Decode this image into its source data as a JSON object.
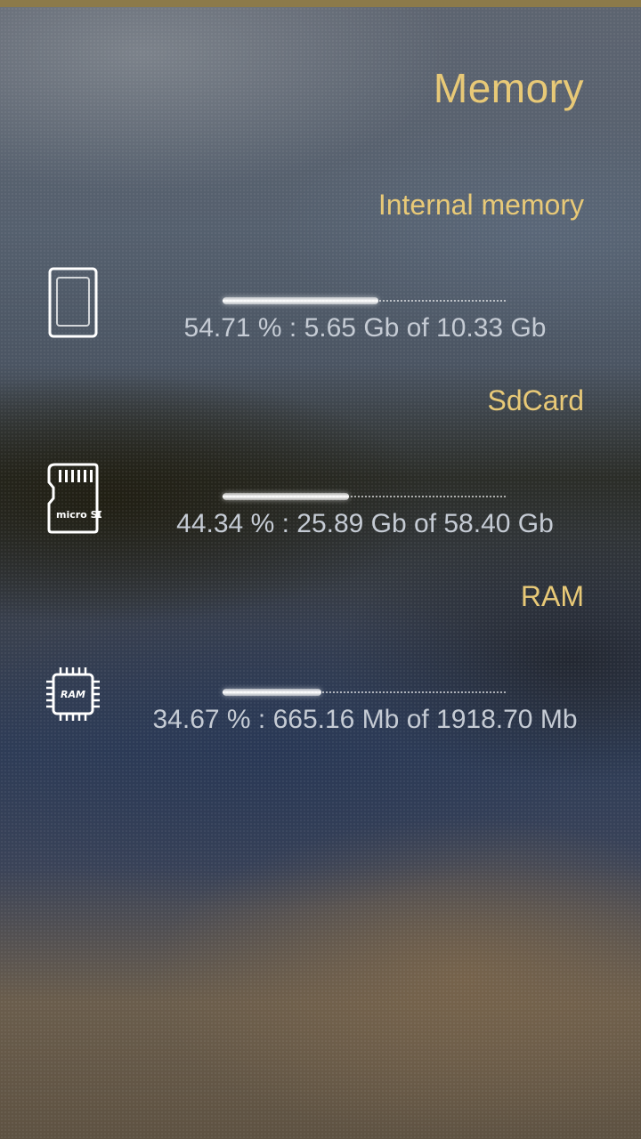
{
  "page": {
    "title": "Memory"
  },
  "sections": [
    {
      "header": "Internal memory",
      "icon": "phone-storage-icon",
      "fraction": 0.5471,
      "stat": "54.71 % : 5.65 Gb of 10.33 Gb"
    },
    {
      "header": "SdCard",
      "icon": "microsd-card-icon",
      "icon_text": "micro SD",
      "fraction": 0.4434,
      "stat": "44.34 % : 25.89 Gb of 58.40 Gb"
    },
    {
      "header": "RAM",
      "icon": "ram-chip-icon",
      "icon_text": "RAM",
      "fraction": 0.3467,
      "stat": "34.67 % : 665.16 Mb of 1918.70 Mb"
    }
  ],
  "colors": {
    "accent": "#e8c977",
    "stat_text": "#c5cbd4",
    "top_bar": "#8c7a4a"
  }
}
